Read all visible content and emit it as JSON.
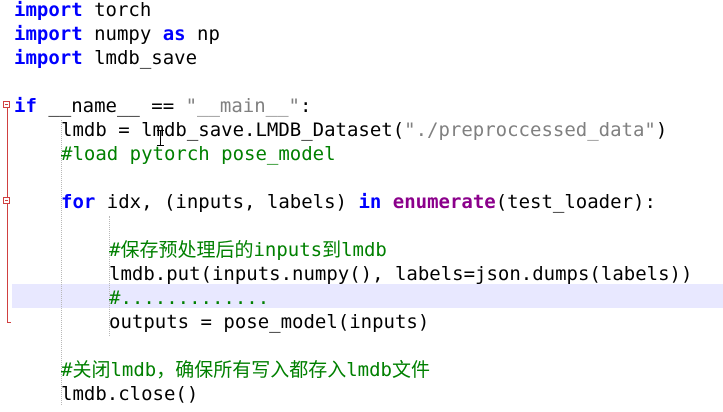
{
  "code": {
    "line1": {
      "kw": "import",
      "rest": " torch"
    },
    "line2": {
      "kw": "import",
      "mid": " numpy ",
      "kw2": "as",
      "rest": " np"
    },
    "line3": {
      "kw": "import",
      "rest": " lmdb_save"
    },
    "line4": {
      "kw": "if",
      "mid": " __name__ == ",
      "str": "\"__main__\"",
      "rest": ":"
    },
    "line5": {
      "pre": "lmdb = lmdb_save.LMDB_Dataset(",
      "str": "\"./preproccessed_data\"",
      "rest": ")"
    },
    "line6": {
      "comment": "#load pytorch pose_model"
    },
    "line7": {
      "kw": "for",
      "mid": " idx, (inputs, labels) ",
      "kw2": "in",
      "sp": " ",
      "fn": "enumerate",
      "rest": "(test_loader):"
    },
    "line8": {
      "comment": "#保存预处理后的inputs到lmdb"
    },
    "line9": {
      "text": "lmdb.put(inputs.numpy(), labels=json.dumps(labels))"
    },
    "line10": {
      "comment": "#............."
    },
    "line11": {
      "text": "outputs = pose_model(inputs)"
    },
    "line12": {
      "comment": "#关闭lmdb，确保所有写入都存入lmdb文件"
    },
    "line13": {
      "text": "lmdb.close()"
    }
  },
  "colors": {
    "keyword": "#0000ff",
    "builtin_function": "#8b008b",
    "string": "#808080",
    "comment": "#008000",
    "current_line": "#e8e8ff",
    "fold_marker": "#d04040"
  },
  "icons": [
    "fold-collapse-icon",
    "fold-end-icon",
    "text-cursor-icon"
  ]
}
